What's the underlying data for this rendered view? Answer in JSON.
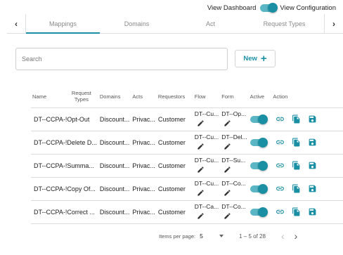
{
  "header": {
    "view_dashboard": "View Dashboard",
    "view_configuration": "View Configuration",
    "toggle_on": true
  },
  "tabs": {
    "prev": "‹",
    "next": "›",
    "items": [
      {
        "label": "Mappings",
        "active": true
      },
      {
        "label": "Domains",
        "active": false
      },
      {
        "label": "Act",
        "active": false
      },
      {
        "label": "Request Types",
        "active": false
      }
    ]
  },
  "search": {
    "placeholder": "Search"
  },
  "new_button": {
    "label": "New",
    "icon": "plus-icon"
  },
  "table": {
    "columns": {
      "name": "Name",
      "request_types": "Request Types",
      "domains": "Domains",
      "acts": "Acts",
      "requestors": "Requestors",
      "flow": "Flow",
      "form": "Form",
      "active": "Active",
      "action": "Action"
    },
    "rows": [
      {
        "name": "DT--CCPA-!Opt-Out",
        "domains": "Discount...",
        "acts": "Privac...",
        "requestors": "Customer",
        "flow": "DT--Cu...",
        "form": "DT--Op...",
        "active": true
      },
      {
        "name": "DT--CCPA-!Delete D...",
        "domains": "Discount...",
        "acts": "Privac...",
        "requestors": "Customer",
        "flow": "DT--Cu...",
        "form": "DT--Del...",
        "active": true
      },
      {
        "name": "DT--CCPA-!Summa...",
        "domains": "Discount...",
        "acts": "Privac...",
        "requestors": "Customer",
        "flow": "DT--Cu...",
        "form": "DT--Su...",
        "active": true
      },
      {
        "name": "DT--CCPA-!Copy Of...",
        "domains": "Discount...",
        "acts": "Privac...",
        "requestors": "Customer",
        "flow": "DT--Cu...",
        "form": "DT--Co...",
        "active": true
      },
      {
        "name": "DT--CCPA-!Correct ...",
        "domains": "Discount...",
        "acts": "Privac...",
        "requestors": "Customer",
        "flow": "DT--Ca...",
        "form": "DT--Co...",
        "active": true
      }
    ]
  },
  "pagination": {
    "items_per_page_label": "Items per page:",
    "items_per_page_value": "5",
    "range": "1 – 5 of 28",
    "prev": "‹",
    "next": "›"
  },
  "colors": {
    "accent": "#1a8fa3",
    "accent_light": "#5ab6c4"
  }
}
